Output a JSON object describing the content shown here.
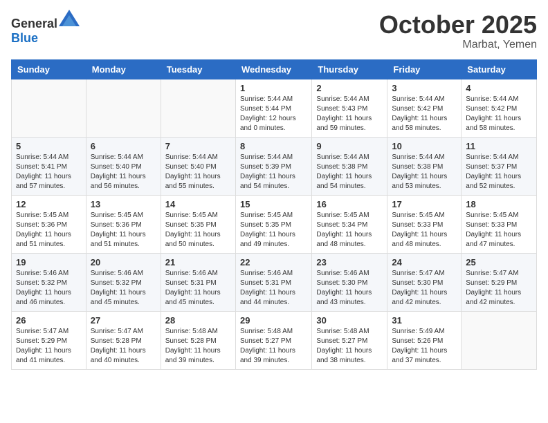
{
  "header": {
    "logo_general": "General",
    "logo_blue": "Blue",
    "month": "October 2025",
    "location": "Marbat, Yemen"
  },
  "weekdays": [
    "Sunday",
    "Monday",
    "Tuesday",
    "Wednesday",
    "Thursday",
    "Friday",
    "Saturday"
  ],
  "weeks": [
    [
      {
        "day": "",
        "sunrise": "",
        "sunset": "",
        "daylight": ""
      },
      {
        "day": "",
        "sunrise": "",
        "sunset": "",
        "daylight": ""
      },
      {
        "day": "",
        "sunrise": "",
        "sunset": "",
        "daylight": ""
      },
      {
        "day": "1",
        "sunrise": "Sunrise: 5:44 AM",
        "sunset": "Sunset: 5:44 PM",
        "daylight": "Daylight: 12 hours and 0 minutes."
      },
      {
        "day": "2",
        "sunrise": "Sunrise: 5:44 AM",
        "sunset": "Sunset: 5:43 PM",
        "daylight": "Daylight: 11 hours and 59 minutes."
      },
      {
        "day": "3",
        "sunrise": "Sunrise: 5:44 AM",
        "sunset": "Sunset: 5:42 PM",
        "daylight": "Daylight: 11 hours and 58 minutes."
      },
      {
        "day": "4",
        "sunrise": "Sunrise: 5:44 AM",
        "sunset": "Sunset: 5:42 PM",
        "daylight": "Daylight: 11 hours and 58 minutes."
      }
    ],
    [
      {
        "day": "5",
        "sunrise": "Sunrise: 5:44 AM",
        "sunset": "Sunset: 5:41 PM",
        "daylight": "Daylight: 11 hours and 57 minutes."
      },
      {
        "day": "6",
        "sunrise": "Sunrise: 5:44 AM",
        "sunset": "Sunset: 5:40 PM",
        "daylight": "Daylight: 11 hours and 56 minutes."
      },
      {
        "day": "7",
        "sunrise": "Sunrise: 5:44 AM",
        "sunset": "Sunset: 5:40 PM",
        "daylight": "Daylight: 11 hours and 55 minutes."
      },
      {
        "day": "8",
        "sunrise": "Sunrise: 5:44 AM",
        "sunset": "Sunset: 5:39 PM",
        "daylight": "Daylight: 11 hours and 54 minutes."
      },
      {
        "day": "9",
        "sunrise": "Sunrise: 5:44 AM",
        "sunset": "Sunset: 5:38 PM",
        "daylight": "Daylight: 11 hours and 54 minutes."
      },
      {
        "day": "10",
        "sunrise": "Sunrise: 5:44 AM",
        "sunset": "Sunset: 5:38 PM",
        "daylight": "Daylight: 11 hours and 53 minutes."
      },
      {
        "day": "11",
        "sunrise": "Sunrise: 5:44 AM",
        "sunset": "Sunset: 5:37 PM",
        "daylight": "Daylight: 11 hours and 52 minutes."
      }
    ],
    [
      {
        "day": "12",
        "sunrise": "Sunrise: 5:45 AM",
        "sunset": "Sunset: 5:36 PM",
        "daylight": "Daylight: 11 hours and 51 minutes."
      },
      {
        "day": "13",
        "sunrise": "Sunrise: 5:45 AM",
        "sunset": "Sunset: 5:36 PM",
        "daylight": "Daylight: 11 hours and 51 minutes."
      },
      {
        "day": "14",
        "sunrise": "Sunrise: 5:45 AM",
        "sunset": "Sunset: 5:35 PM",
        "daylight": "Daylight: 11 hours and 50 minutes."
      },
      {
        "day": "15",
        "sunrise": "Sunrise: 5:45 AM",
        "sunset": "Sunset: 5:35 PM",
        "daylight": "Daylight: 11 hours and 49 minutes."
      },
      {
        "day": "16",
        "sunrise": "Sunrise: 5:45 AM",
        "sunset": "Sunset: 5:34 PM",
        "daylight": "Daylight: 11 hours and 48 minutes."
      },
      {
        "day": "17",
        "sunrise": "Sunrise: 5:45 AM",
        "sunset": "Sunset: 5:33 PM",
        "daylight": "Daylight: 11 hours and 48 minutes."
      },
      {
        "day": "18",
        "sunrise": "Sunrise: 5:45 AM",
        "sunset": "Sunset: 5:33 PM",
        "daylight": "Daylight: 11 hours and 47 minutes."
      }
    ],
    [
      {
        "day": "19",
        "sunrise": "Sunrise: 5:46 AM",
        "sunset": "Sunset: 5:32 PM",
        "daylight": "Daylight: 11 hours and 46 minutes."
      },
      {
        "day": "20",
        "sunrise": "Sunrise: 5:46 AM",
        "sunset": "Sunset: 5:32 PM",
        "daylight": "Daylight: 11 hours and 45 minutes."
      },
      {
        "day": "21",
        "sunrise": "Sunrise: 5:46 AM",
        "sunset": "Sunset: 5:31 PM",
        "daylight": "Daylight: 11 hours and 45 minutes."
      },
      {
        "day": "22",
        "sunrise": "Sunrise: 5:46 AM",
        "sunset": "Sunset: 5:31 PM",
        "daylight": "Daylight: 11 hours and 44 minutes."
      },
      {
        "day": "23",
        "sunrise": "Sunrise: 5:46 AM",
        "sunset": "Sunset: 5:30 PM",
        "daylight": "Daylight: 11 hours and 43 minutes."
      },
      {
        "day": "24",
        "sunrise": "Sunrise: 5:47 AM",
        "sunset": "Sunset: 5:30 PM",
        "daylight": "Daylight: 11 hours and 42 minutes."
      },
      {
        "day": "25",
        "sunrise": "Sunrise: 5:47 AM",
        "sunset": "Sunset: 5:29 PM",
        "daylight": "Daylight: 11 hours and 42 minutes."
      }
    ],
    [
      {
        "day": "26",
        "sunrise": "Sunrise: 5:47 AM",
        "sunset": "Sunset: 5:29 PM",
        "daylight": "Daylight: 11 hours and 41 minutes."
      },
      {
        "day": "27",
        "sunrise": "Sunrise: 5:47 AM",
        "sunset": "Sunset: 5:28 PM",
        "daylight": "Daylight: 11 hours and 40 minutes."
      },
      {
        "day": "28",
        "sunrise": "Sunrise: 5:48 AM",
        "sunset": "Sunset: 5:28 PM",
        "daylight": "Daylight: 11 hours and 39 minutes."
      },
      {
        "day": "29",
        "sunrise": "Sunrise: 5:48 AM",
        "sunset": "Sunset: 5:27 PM",
        "daylight": "Daylight: 11 hours and 39 minutes."
      },
      {
        "day": "30",
        "sunrise": "Sunrise: 5:48 AM",
        "sunset": "Sunset: 5:27 PM",
        "daylight": "Daylight: 11 hours and 38 minutes."
      },
      {
        "day": "31",
        "sunrise": "Sunrise: 5:49 AM",
        "sunset": "Sunset: 5:26 PM",
        "daylight": "Daylight: 11 hours and 37 minutes."
      },
      {
        "day": "",
        "sunrise": "",
        "sunset": "",
        "daylight": ""
      }
    ]
  ]
}
